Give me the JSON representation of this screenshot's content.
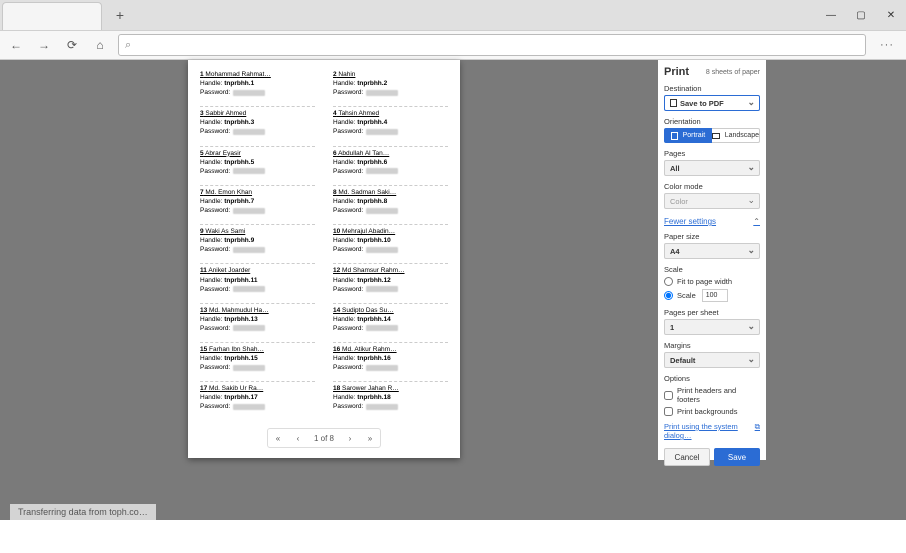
{
  "window": {
    "minimize": "—",
    "maximize": "▢",
    "close": "✕",
    "newtab": "+"
  },
  "toolbar": {
    "back": "←",
    "forward": "→",
    "refresh": "⟳",
    "home": "⌂",
    "search_icon": "⌕",
    "more": "···"
  },
  "preview": {
    "left": [
      {
        "n": "1",
        "name": "Mohammad Rahmat…",
        "handle": "tnprbhh.1"
      },
      {
        "n": "3",
        "name": "Sabbir Ahmed",
        "handle": "tnprbhh.3"
      },
      {
        "n": "5",
        "name": "Abrar Eyasir",
        "handle": "tnprbhh.5"
      },
      {
        "n": "7",
        "name": "Md. Emon Khan",
        "handle": "tnprbhh.7"
      },
      {
        "n": "9",
        "name": "Waki As Sami",
        "handle": "tnprbhh.9"
      },
      {
        "n": "11",
        "name": "Aniket Joarder",
        "handle": "tnprbhh.11"
      },
      {
        "n": "13",
        "name": "Md. Mahmudul Ha…",
        "handle": "tnprbhh.13"
      },
      {
        "n": "15",
        "name": "Farhan Ibn Shah…",
        "handle": "tnprbhh.15"
      },
      {
        "n": "17",
        "name": "Md. Sakib Ur Ra…",
        "handle": "tnprbhh.17"
      }
    ],
    "right": [
      {
        "n": "2",
        "name": "Nahin",
        "handle": "tnprbhh.2"
      },
      {
        "n": "4",
        "name": "Tahsin Ahmed",
        "handle": "tnprbhh.4"
      },
      {
        "n": "6",
        "name": "Abdullah Al Tan…",
        "handle": "tnprbhh.6"
      },
      {
        "n": "8",
        "name": "Md. Sadman Saki…",
        "handle": "tnprbhh.8"
      },
      {
        "n": "10",
        "name": "Mehrajul Abadin…",
        "handle": "tnprbhh.10"
      },
      {
        "n": "12",
        "name": "Md Shamsur Rahm…",
        "handle": "tnprbhh.12"
      },
      {
        "n": "14",
        "name": "Sudipto Das Su…",
        "handle": "tnprbhh.14"
      },
      {
        "n": "16",
        "name": "Md. Atikur Rahm…",
        "handle": "tnprbhh.16"
      },
      {
        "n": "18",
        "name": "Sarower Jahan R…",
        "handle": "tnprbhh.18"
      }
    ],
    "handle_label": "Handle:",
    "password_label": "Password:",
    "pager": {
      "first": "«",
      "prev": "‹",
      "text": "1 of 8",
      "next": "›",
      "last": "»"
    }
  },
  "panel": {
    "title": "Print",
    "sheets": "8 sheets of paper",
    "destination_label": "Destination",
    "destination_value": "Save to PDF",
    "orientation_label": "Orientation",
    "portrait": "Portrait",
    "landscape": "Landscape",
    "pages_label": "Pages",
    "pages_value": "All",
    "color_label": "Color mode",
    "color_value": "Color",
    "fewer": "Fewer settings",
    "paper_label": "Paper size",
    "paper_value": "A4",
    "scale_label": "Scale",
    "fit": "Fit to page width",
    "scale": "Scale",
    "scale_value": "100",
    "pps_label": "Pages per sheet",
    "pps_value": "1",
    "margins_label": "Margins",
    "margins_value": "Default",
    "options_label": "Options",
    "headers": "Print headers and footers",
    "backgrounds": "Print backgrounds",
    "system_link": "Print using the system dialog…",
    "external": "⧉",
    "cancel": "Cancel",
    "save": "Save"
  },
  "status": "Transferring data from toph.co…"
}
